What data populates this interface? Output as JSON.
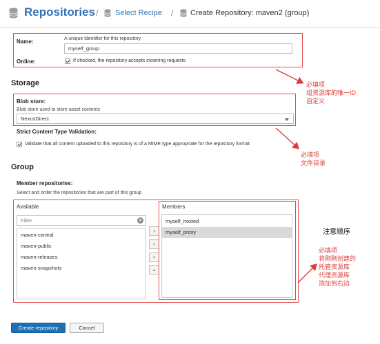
{
  "header": {
    "title": "Repositories",
    "breadcrumb_1": "Select Recipe",
    "breadcrumb_2": "Create Repository: maven2 (group)",
    "separator": "/",
    "title_icon": "database-icon",
    "crumb_icon": "database-icon"
  },
  "name_field": {
    "label": "Name:",
    "hint": "A unique identifier for this repository",
    "value": "myself_group"
  },
  "online_field": {
    "label": "Online:",
    "checked": true,
    "text": "If checked, the repository accepts incoming requests"
  },
  "storage": {
    "heading": "Storage",
    "blob_label": "Blob store:",
    "blob_hint": "Blob store used to store asset contents",
    "blob_value": "NexusDirect",
    "strict_label": "Strict Content Type Validation:",
    "strict_checked": true,
    "strict_text": "Validate that all content uploaded to this repository is of a MIME type appropriate for the repository format"
  },
  "group": {
    "heading": "Group",
    "members_label": "Member repositories:",
    "members_hint": "Select and order the repositories that are part of this group",
    "available_title": "Available",
    "filter_placeholder": "Filter",
    "available": [
      "maven-central",
      "maven-public",
      "maven-releases",
      "maven-snapshots"
    ],
    "members_title": "Members",
    "members": [
      "myself_hosted",
      "myself_proxy"
    ],
    "selected_member": "myself_proxy",
    "move_buttons": [
      "›",
      "‹",
      "‹",
      "⌄"
    ]
  },
  "buttons": {
    "create": "Create repository",
    "cancel": "Cancel"
  },
  "annotations": {
    "a1_line1": "必填项",
    "a1_line2": "组资源库的唯一ID",
    "a1_line3": "自定义",
    "a2_line1": "必填项",
    "a2_line2": "文件目录",
    "note": "注意顺序",
    "a3_line1": "必填项",
    "a3_line2": "将刚刚创建的",
    "a3_line3": "托管资源库",
    "a3_line4": "代理资源库",
    "a3_line5": "添加到右边"
  },
  "colors": {
    "brand": "#2f72b6",
    "primary_button": "#1f6fb5",
    "annotation": "#e03a3a"
  }
}
